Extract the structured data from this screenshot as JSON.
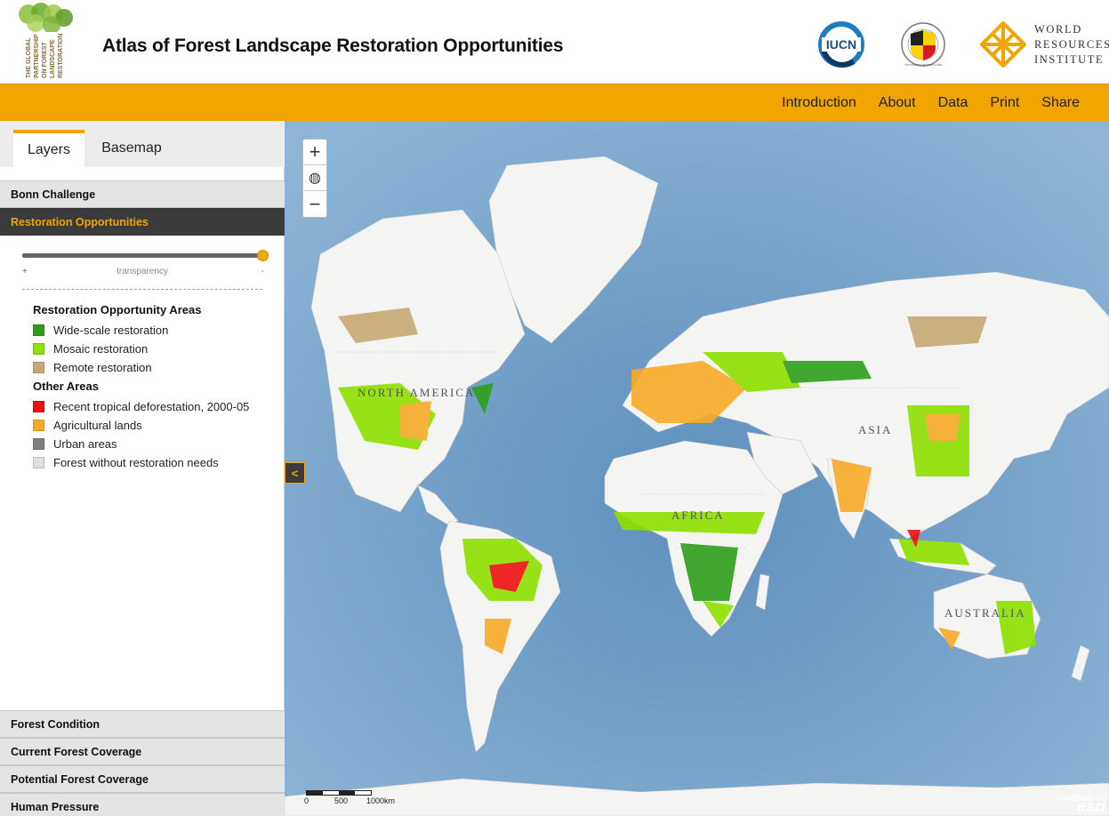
{
  "header": {
    "title": "Atlas of Forest Landscape Restoration Opportunities",
    "gpflr_logo_text": "THE GLOBAL PARTNERSHIP ON FOREST LANDSCAPE RESTORATION",
    "iucn_logo_text": "IUCN",
    "umd_logo_text": "UNIVERSITY OF MARYLAND",
    "wri_line1": "WORLD",
    "wri_line2": "RESOURCES",
    "wri_line3": "INSTITUTE"
  },
  "nav": {
    "items": [
      "Introduction",
      "About",
      "Data",
      "Print",
      "Share"
    ]
  },
  "sidebar": {
    "tabs": [
      "Layers",
      "Basemap"
    ],
    "accordion_top": [
      "Bonn Challenge",
      "Restoration Opportunities"
    ],
    "accordion_bottom": [
      "Forest Condition",
      "Current Forest Coverage",
      "Potential Forest Coverage",
      "Human Pressure"
    ],
    "slider": {
      "plus": "+",
      "label": "transparency",
      "minus": "-",
      "value": 1.0
    },
    "legend": {
      "heading1": "Restoration Opportunity Areas",
      "group1": [
        {
          "label": "Wide-scale restoration",
          "color": "#2e9e1a"
        },
        {
          "label": "Mosaic restoration",
          "color": "#8ee000"
        },
        {
          "label": "Remote restoration",
          "color": "#c8a872"
        }
      ],
      "heading2": "Other Areas",
      "group2": [
        {
          "label": "Recent tropical deforestation, 2000-05",
          "color": "#ee1010"
        },
        {
          "label": "Agricultural lands",
          "color": "#f7ab28"
        },
        {
          "label": "Urban areas",
          "color": "#808080"
        },
        {
          "label": "Forest without restoration needs",
          "color": "#e0e0e0"
        }
      ]
    }
  },
  "map": {
    "zoom_in": "+",
    "home": "◍",
    "zoom_out": "−",
    "collapse": "<",
    "labels": {
      "north_america": "NORTH AMERICA",
      "asia": "ASIA",
      "africa": "AFRICA",
      "australia": "AUSTRALIA"
    },
    "scale": {
      "s0": "0",
      "s1": "500",
      "s2": "1000km"
    },
    "esri_powered": "POWERED BY",
    "esri": "esri"
  }
}
